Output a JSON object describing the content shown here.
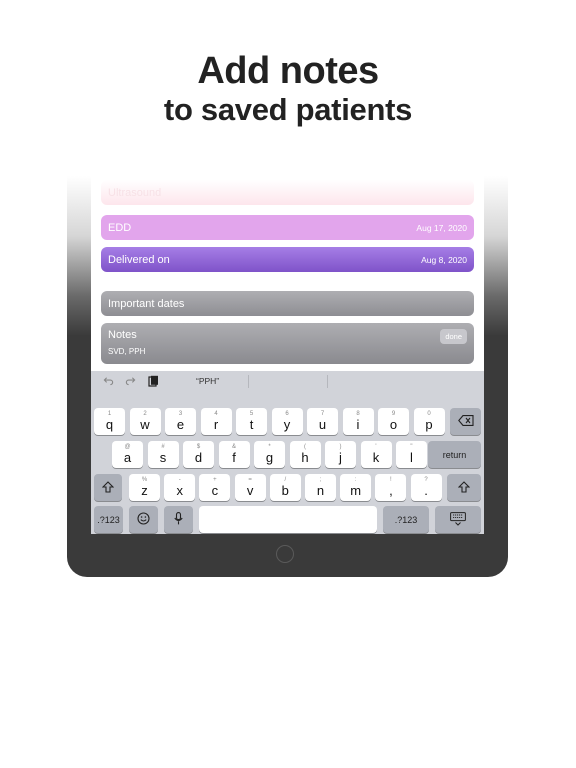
{
  "headline": {
    "title": "Add notes",
    "subtitle": "to saved patients"
  },
  "rows": {
    "ultrasound": {
      "label": "Ultrasound"
    },
    "edd": {
      "label": "EDD",
      "value": "Aug 17, 2020"
    },
    "delivered": {
      "label": "Delivered on",
      "value": "Aug 8, 2020"
    },
    "important": {
      "label": "Important dates"
    },
    "notes": {
      "label": "Notes",
      "text": "SVD, PPH",
      "done_label": "done"
    }
  },
  "keyboard": {
    "suggestion": "“PPH”",
    "row1": [
      {
        "sub": "1",
        "key": "q"
      },
      {
        "sub": "2",
        "key": "w"
      },
      {
        "sub": "3",
        "key": "e"
      },
      {
        "sub": "4",
        "key": "r"
      },
      {
        "sub": "5",
        "key": "t"
      },
      {
        "sub": "6",
        "key": "y"
      },
      {
        "sub": "7",
        "key": "u"
      },
      {
        "sub": "8",
        "key": "i"
      },
      {
        "sub": "9",
        "key": "o"
      },
      {
        "sub": "0",
        "key": "p"
      }
    ],
    "row2": [
      {
        "sub": "@",
        "key": "a"
      },
      {
        "sub": "#",
        "key": "s"
      },
      {
        "sub": "$",
        "key": "d"
      },
      {
        "sub": "&",
        "key": "f"
      },
      {
        "sub": "*",
        "key": "g"
      },
      {
        "sub": "(",
        "key": "h"
      },
      {
        "sub": ")",
        "key": "j"
      },
      {
        "sub": "'",
        "key": "k"
      },
      {
        "sub": "\"",
        "key": "l"
      }
    ],
    "row3": [
      {
        "sub": "%",
        "key": "z"
      },
      {
        "sub": "-",
        "key": "x"
      },
      {
        "sub": "+",
        "key": "c"
      },
      {
        "sub": "=",
        "key": "v"
      },
      {
        "sub": "/",
        "key": "b"
      },
      {
        "sub": ";",
        "key": "n"
      },
      {
        "sub": ":",
        "key": "m"
      },
      {
        "sub": "!",
        "key": ","
      },
      {
        "sub": "?",
        "key": "."
      }
    ],
    "return_label": "return",
    "num_label": ".?123",
    "icons": {
      "backspace": "backspace-icon",
      "shift": "shift-icon",
      "emoji": "emoji-icon",
      "mic": "mic-icon",
      "hide": "keyboard-hide-icon",
      "undo": "undo-icon",
      "redo": "redo-icon",
      "paste": "paste-icon"
    }
  }
}
